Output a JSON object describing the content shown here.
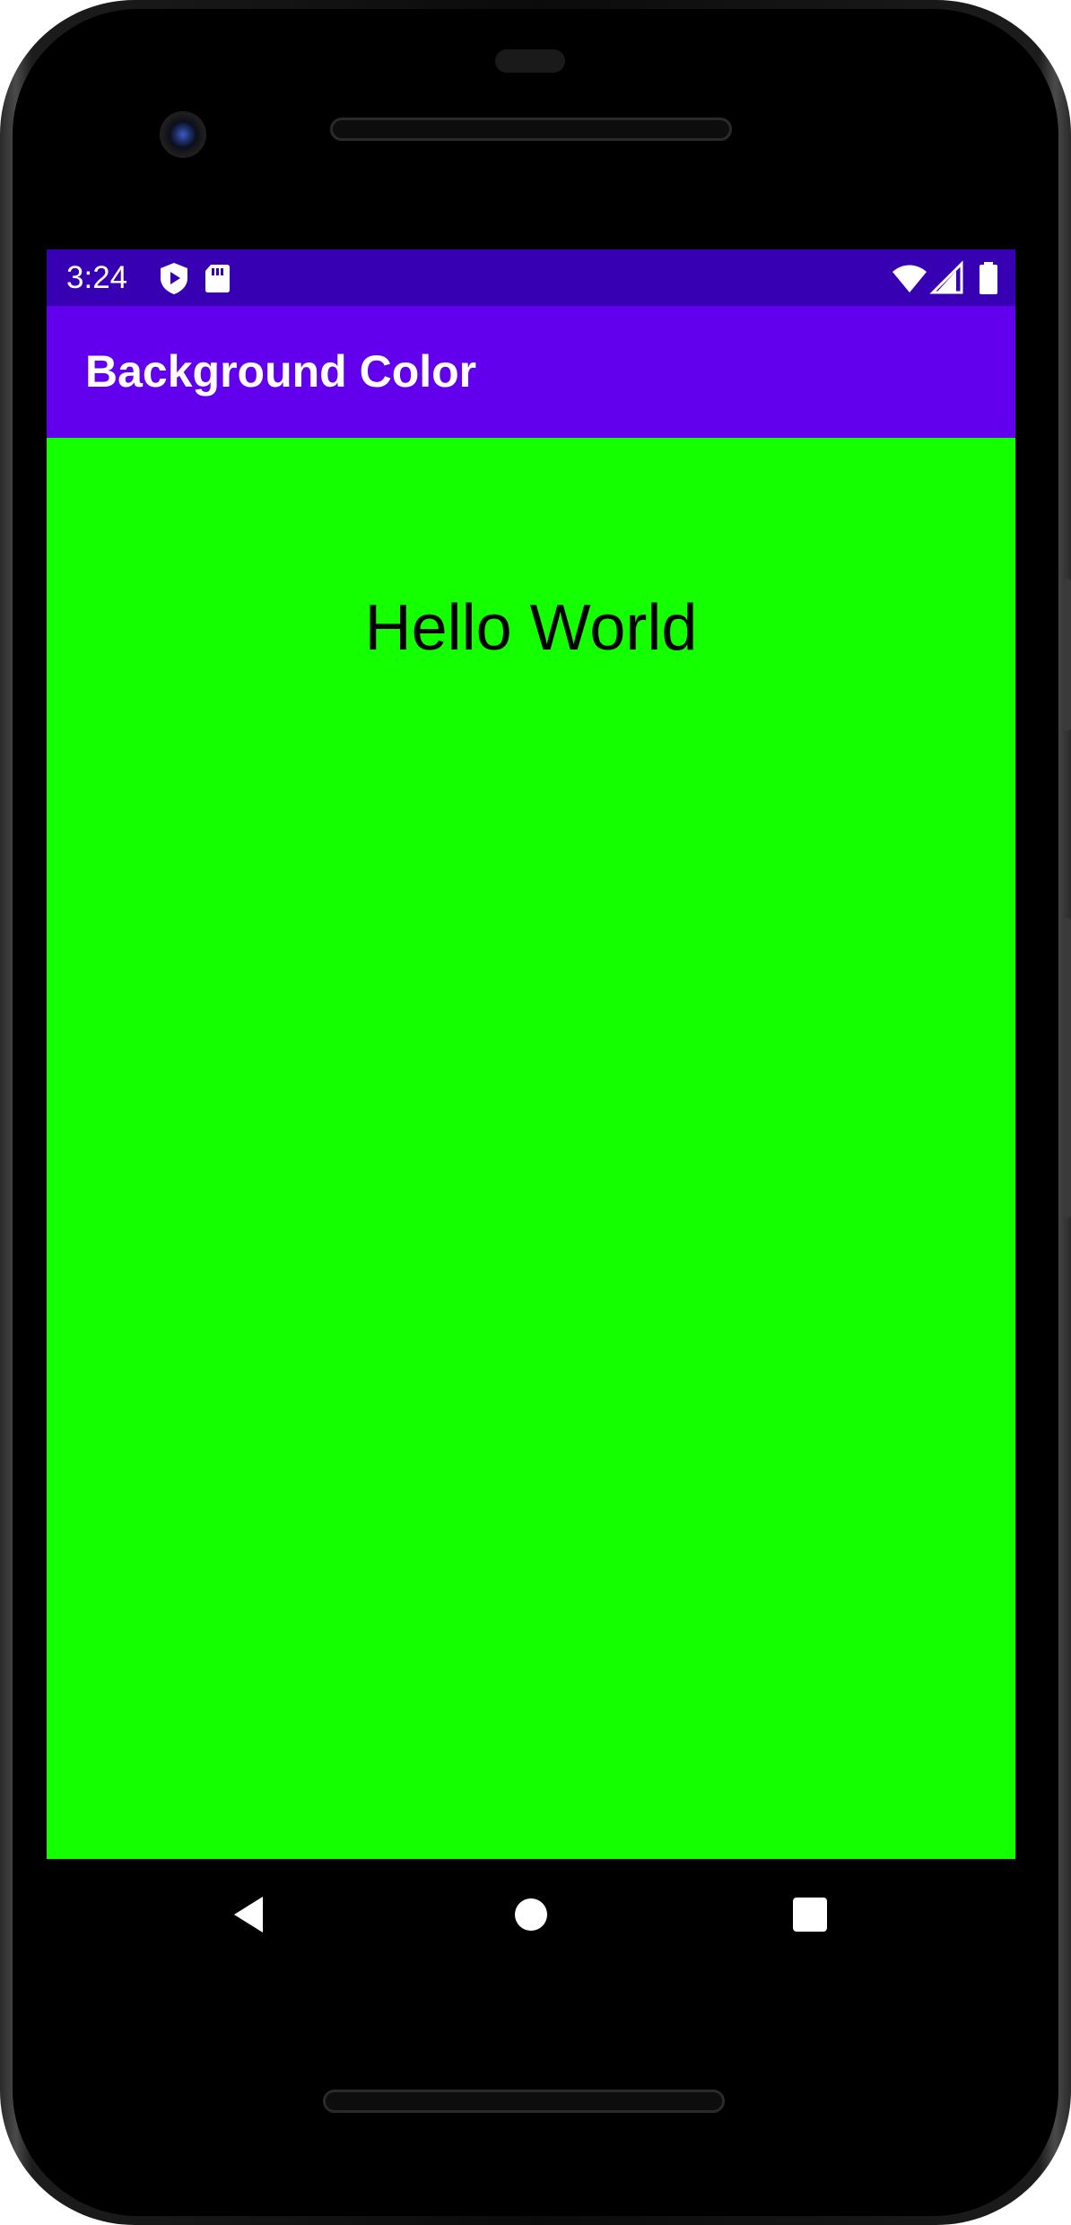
{
  "status_bar": {
    "time": "3:24",
    "icons_left": [
      "play-protect-icon",
      "sd-card-icon"
    ],
    "icons_right": [
      "wifi-icon",
      "cellular-signal-icon",
      "battery-icon"
    ],
    "color": "#3700b3"
  },
  "app_bar": {
    "title": "Background Color",
    "color": "#6200ee"
  },
  "content": {
    "text": "Hello World",
    "background_color": "#14ff00"
  },
  "nav_bar": {
    "buttons": [
      "back-icon",
      "home-icon",
      "recents-icon"
    ]
  }
}
